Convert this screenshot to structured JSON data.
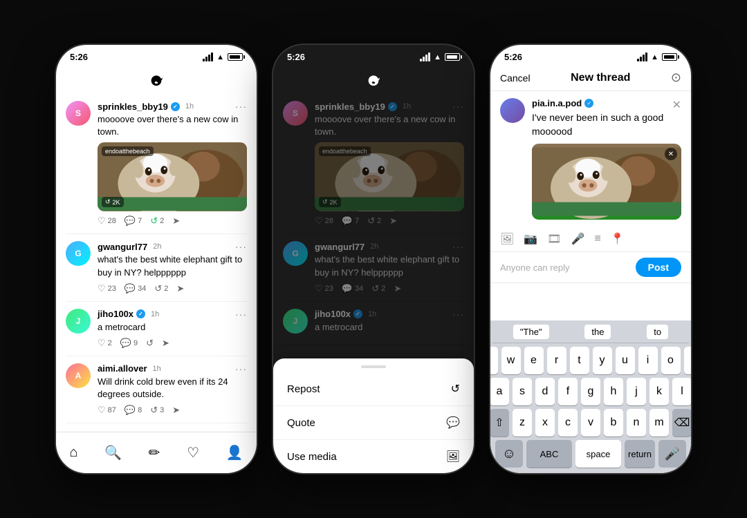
{
  "colors": {
    "background": "#0a0a0a",
    "lightPhone": "#ffffff",
    "darkPhone": "#1a1a1a",
    "accent": "#1d9bf0",
    "postBtn": "#0095f6"
  },
  "phone1": {
    "statusBar": {
      "time": "5:26",
      "signal": "signal",
      "wifi": "wifi",
      "battery": "battery"
    },
    "posts": [
      {
        "user": "sprinkles_bby19",
        "verified": true,
        "time": "1h",
        "text": "moooove over there's a new cow in town.",
        "hasImage": true,
        "imageLabel": "endoatthebeach",
        "imageRepostCount": "2K",
        "likes": "28",
        "comments": "7",
        "reposts": "2",
        "repostActive": true
      },
      {
        "user": "gwangurl77",
        "verified": false,
        "time": "2h",
        "text": "what's the best white elephant gift to buy in NY? helpppppp",
        "hasImage": false,
        "likes": "23",
        "comments": "34",
        "reposts": "2",
        "repostActive": false
      },
      {
        "user": "jiho100x",
        "verified": true,
        "time": "1h",
        "text": "a metrocard",
        "hasImage": false,
        "likes": "2",
        "comments": "9",
        "reposts": "",
        "repostActive": false
      },
      {
        "user": "aimi.allover",
        "verified": false,
        "time": "1h",
        "text": "Will drink cold brew even if its 24 degrees outside.",
        "hasImage": false,
        "likes": "87",
        "comments": "8",
        "reposts": "3",
        "repostActive": false
      }
    ],
    "bottomNav": [
      "home",
      "search",
      "compose",
      "heart",
      "person"
    ]
  },
  "phone2": {
    "statusBar": {
      "time": "5:26"
    },
    "posts": [
      {
        "user": "sprinkles_bby19",
        "verified": true,
        "time": "1h",
        "text": "moooove over there's a new cow in town.",
        "hasImage": true,
        "imageLabel": "endoatthebeach",
        "imageRepostCount": "2K",
        "likes": "28",
        "comments": "7",
        "reposts": "2",
        "repostActive": false
      },
      {
        "user": "gwangurl77",
        "verified": false,
        "time": "2h",
        "text": "what's the best white elephant gift to buy in NY? helpppppp",
        "hasImage": false,
        "likes": "23",
        "comments": "34",
        "reposts": "2",
        "repostActive": false
      },
      {
        "user": "jiho100x",
        "verified": true,
        "time": "1h",
        "text": "a metrocard",
        "hasImage": false,
        "likes": "",
        "comments": "",
        "reposts": "",
        "repostActive": false
      }
    ],
    "bottomSheet": {
      "repost": "Repost",
      "quote": "Quote",
      "useMedia": "Use media"
    }
  },
  "phone3": {
    "statusBar": {
      "time": "5:26"
    },
    "compose": {
      "cancel": "Cancel",
      "title": "New thread",
      "user": "pia.in.a.pod",
      "verified": true,
      "inputText": "I've never been in such a good moooood",
      "footerHint": "Anyone can reply",
      "postBtn": "Post"
    },
    "keyboard": {
      "suggestions": [
        "\"The\"",
        "the",
        "to"
      ],
      "rows": [
        [
          "q",
          "w",
          "e",
          "r",
          "t",
          "y",
          "u",
          "i",
          "o",
          "p"
        ],
        [
          "a",
          "s",
          "d",
          "f",
          "g",
          "h",
          "j",
          "k",
          "l"
        ],
        [
          "z",
          "x",
          "c",
          "v",
          "b",
          "n",
          "m"
        ]
      ],
      "bottomRow": {
        "abc": "ABC",
        "space": "space",
        "return": "return"
      }
    }
  }
}
